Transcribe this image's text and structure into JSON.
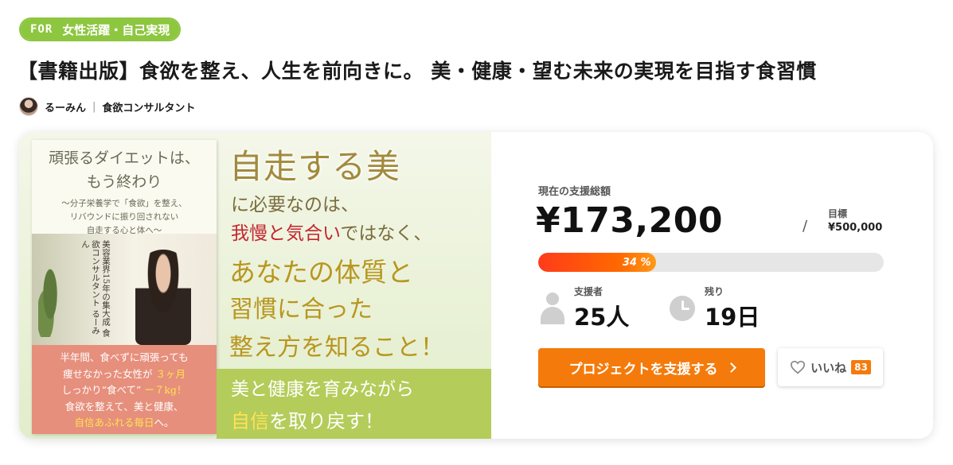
{
  "category": {
    "prefix": "FOR",
    "label": "女性活躍・自己実現"
  },
  "project_title": "【書籍出版】食欲を整え、人生を前向きに。 美・健康・望む未来の実現を目指す食習慣",
  "author": {
    "name": "るーみん",
    "role": "食欲コンサルタント",
    "separator": "|"
  },
  "hero": {
    "book_title_line1": "頑張るダイエットは、",
    "book_title_line2": "もう終わり",
    "book_sub_line1": "〜分子栄養学で「食欲」を整え、",
    "book_sub_line2": "リバウンドに振り回されない",
    "book_sub_line3": "自走する心と体へ〜",
    "book_vertical": "美容業界15年の集大成 食欲コンサルタント るーみん",
    "book_bottom_line1": "半年間、食べずに頑張っても",
    "book_bottom_line2a": "痩せなかった女性が",
    "book_bottom_line2b": "３ヶ月",
    "book_bottom_line3a": "しっかり“食べて”",
    "book_bottom_line3b": "ー７kg！",
    "book_bottom_line4": "食欲を整えて、美と健康、",
    "book_bottom_line5a": "自信あふれる毎日",
    "book_bottom_line5b": "へ。",
    "headline1": "自走する美",
    "headline2": "に必要なのは、",
    "headline3a": "我慢と気合い",
    "headline3b": "ではなく、",
    "headline4": "あなたの体質と",
    "headline5": "習慣に合った",
    "headline6": "整え方を知ること！",
    "band_line1": "美と健康を育みながら",
    "band_line2a": "自信",
    "band_line2b": "を取り戻す！"
  },
  "funding": {
    "current_label": "現在の支援総額",
    "current_amount": "¥173,200",
    "slash": "/",
    "goal_label": "目標",
    "goal_amount": "¥500,000",
    "progress_percent": 34,
    "progress_text": "34 %",
    "supporters_label": "支援者",
    "supporters_value": "25人",
    "remaining_label": "残り",
    "remaining_value": "19日"
  },
  "actions": {
    "support_label": "プロジェクトを支援する",
    "like_label": "いいね",
    "like_count": "83"
  },
  "colors": {
    "accent": "#f47b0b",
    "category": "#8dc63f",
    "progress_start": "#ff3b1a"
  }
}
